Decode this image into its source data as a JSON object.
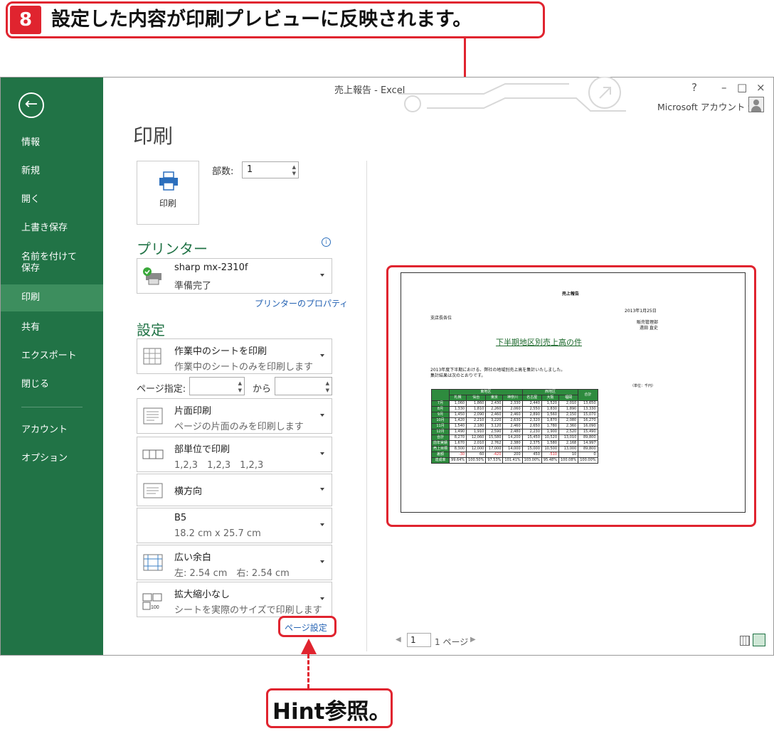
{
  "step": {
    "number": "8",
    "text": "設定した内容が印刷プレビューに反映されます。"
  },
  "window": {
    "title": "売上報告 - Excel",
    "help": "?",
    "minimize": "–",
    "maximize": "□",
    "close": "×",
    "account": "Microsoft アカウント ▾"
  },
  "sidebar": {
    "back": "←",
    "items": [
      {
        "label": "情報"
      },
      {
        "label": "新規"
      },
      {
        "label": "開く"
      },
      {
        "label": "上書き保存"
      },
      {
        "label": "名前を付けて\n保存"
      },
      {
        "label": "印刷"
      },
      {
        "label": "共有"
      },
      {
        "label": "エクスポート"
      },
      {
        "label": "閉じる"
      },
      {
        "label": "アカウント"
      },
      {
        "label": "オプション"
      }
    ]
  },
  "print": {
    "title": "印刷",
    "button_label": "印刷",
    "copies_label": "部数:",
    "copies_value": "1"
  },
  "printer": {
    "section_title": "プリンター",
    "name": "sharp mx-2310f",
    "status": "準備完了",
    "properties_link": "プリンターのプロパティ"
  },
  "settings": {
    "section_title": "設定",
    "what": {
      "label": "作業中のシートを印刷",
      "desc": "作業中のシートのみを印刷します"
    },
    "pages_label": "ページ指定:",
    "pages_to": "から",
    "sides": {
      "label": "片面印刷",
      "desc": "ページの片面のみを印刷します"
    },
    "collate": {
      "label": "部単位で印刷",
      "desc": "1,2,3　1,2,3　1,2,3"
    },
    "orientation": {
      "label": "横方向"
    },
    "paper": {
      "label": "B5",
      "desc": "18.2 cm x 25.7 cm"
    },
    "margins": {
      "label": "広い余白",
      "desc": "左: 2.54 cm　右: 2.54 cm"
    },
    "scaling": {
      "label": "拡大縮小なし",
      "desc": "シートを実際のサイズで印刷します"
    },
    "page_setup_link": "ページ設定"
  },
  "preview": {
    "page_number": "1",
    "page_total": "1 ページ",
    "sheet": {
      "title": "売上報告",
      "date": "2013年1月25日",
      "to": "支店長各位",
      "from_dept": "販売管理部",
      "from_name": "遠田 直史",
      "subject": "下半期地区別売上高の件",
      "body1": "2013年度下半期における、弊社の地域別売上高を集計いたしました。",
      "body2": "集計結果は次のとおりです。",
      "unit": "（単位：千円）",
      "region_east": "東地区",
      "region_west": "西地区",
      "total_header": "合計",
      "columns": [
        "札幌",
        "仙台",
        "東京",
        "神奈川",
        "名古屋",
        "大阪",
        "福岡"
      ],
      "rows": [
        {
          "label": "7月",
          "values": [
            "1,060",
            "1,860",
            "2,430",
            "2,330",
            "2,440",
            "1,520",
            "2,010",
            "13,650"
          ]
        },
        {
          "label": "8月",
          "values": [
            "1,330",
            "1,810",
            "2,260",
            "2,060",
            "2,550",
            "1,830",
            "1,890",
            "13,330"
          ]
        },
        {
          "label": "9月",
          "values": [
            "1,450",
            "2,090",
            "2,460",
            "2,460",
            "2,890",
            "1,560",
            "2,150",
            "15,070"
          ]
        },
        {
          "label": "10月",
          "values": [
            "1,420",
            "2,210",
            "3,220",
            "2,630",
            "2,320",
            "1,870",
            "2,080",
            "16,270"
          ]
        },
        {
          "label": "11月",
          "values": [
            "1,540",
            "2,180",
            "3,120",
            "2,460",
            "2,650",
            "1,780",
            "2,360",
            "16,090"
          ]
        },
        {
          "label": "12月",
          "values": [
            "1,490",
            "1,910",
            "2,590",
            "2,480",
            "2,230",
            "1,900",
            "2,520",
            "15,490"
          ]
        },
        {
          "label": "合計",
          "values": [
            "8,270",
            "12,060",
            "15,580",
            "14,200",
            "15,450",
            "10,520",
            "13,010",
            "89,800"
          ]
        },
        {
          "label": "前年実績",
          "values": [
            "1,670",
            "2,010",
            "2,762",
            "2,380",
            "2,375",
            "1,580",
            "2,168",
            "14,997"
          ]
        },
        {
          "label": "売上目標",
          "values": [
            "8,300",
            "12,000",
            "17,000",
            "14,000",
            "15,000",
            "10,500",
            "13,000",
            "89,800"
          ]
        },
        {
          "label": "差額",
          "values": [
            "-30",
            "60",
            "-420",
            "200",
            "450",
            "-510",
            "10",
            "0"
          ]
        },
        {
          "label": "達成率",
          "values": [
            "99.64%",
            "100.50%",
            "97.53%",
            "101.41%",
            "103.00%",
            "95.48%",
            "100.08%",
            "100.00%"
          ]
        }
      ]
    }
  },
  "hint": {
    "text": "Hint参照。"
  },
  "colors": {
    "accent_red": "#e0242f",
    "excel_green": "#217346"
  }
}
